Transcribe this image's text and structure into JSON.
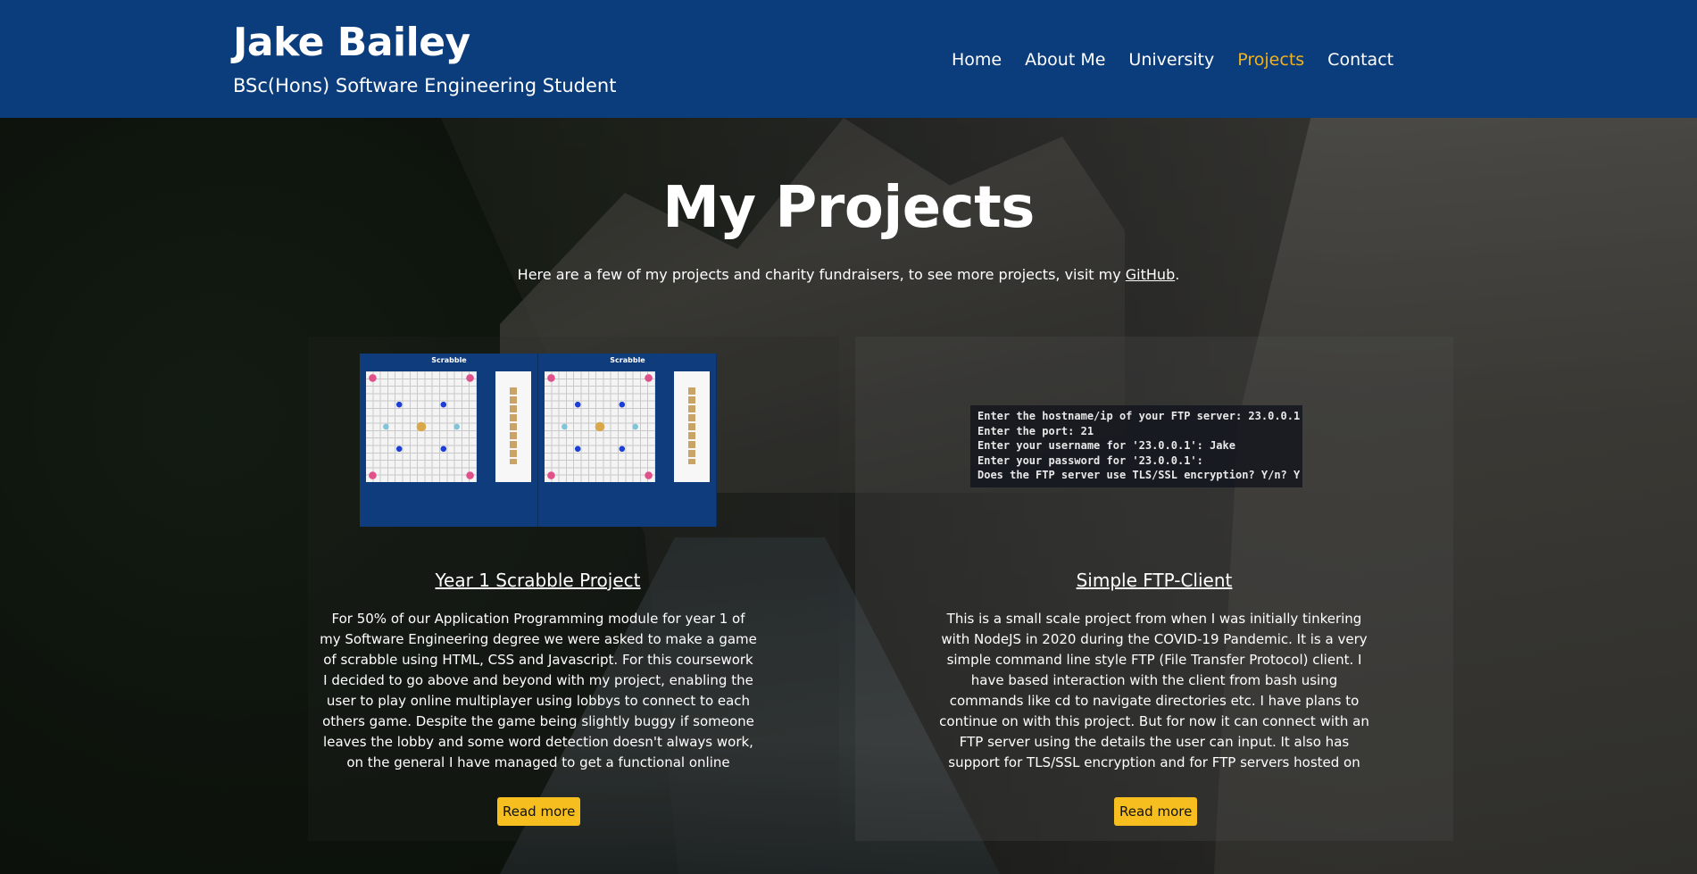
{
  "header": {
    "title": "Jake Bailey",
    "subtitle": "BSc(Hons) Software Engineering Student",
    "nav": [
      {
        "label": "Home",
        "active": false
      },
      {
        "label": "About Me",
        "active": false
      },
      {
        "label": "University",
        "active": false
      },
      {
        "label": "Projects",
        "active": true
      },
      {
        "label": "Contact",
        "active": false
      }
    ],
    "background_color": "#0b3c7c",
    "active_color": "#f2b21a"
  },
  "main": {
    "title": "My Projects",
    "intro_text": "Here are a few of my projects and charity fundraisers, to see more projects, visit my ",
    "intro_link": "GitHub",
    "intro_end": ".",
    "projects": [
      {
        "thumbnail_label_1": "Scrabble",
        "thumbnail_label_2": "Scrabble",
        "title": "Year 1 Scrabble Project",
        "body": "For 50% of our Application Programming module for year 1 of my Software Engineering degree we were asked to make a game of scrabble using HTML, CSS and Javascript. For this coursework I decided to go above and beyond with my project, enabling the user to play online multiplayer using lobbys to connect to each others game. Despite the game being slightly buggy if someone leaves the lobby and some word detection doesn't always work, on the general I have managed to get a functional online multiplayer",
        "button": "Read more"
      },
      {
        "terminal_lines": [
          "Enter the hostname/ip of your FTP server: 23.0.0.1",
          "Enter the port: 21",
          "Enter your username for '23.0.0.1': Jake",
          "Enter your password for '23.0.0.1':",
          "Does the FTP server use TLS/SSL encryption? Y/n? Y"
        ],
        "title": "Simple FTP-Client",
        "body": "This is a small scale project from when I was initially tinkering with NodeJS in 2020 during the COVID-19 Pandemic. It is a very simple command line style FTP (File Transfer Protocol) client. I have based interaction with the client from bash using commands like cd to navigate directories etc. I have plans to continue on with this project. But for now it can connect with an FTP server using the details the user can input. It also has support for TLS/SSL encryption and for FTP servers hosted on different ports. It can also currently",
        "button": "Read more"
      }
    ],
    "button_color": "#f6bf1f"
  }
}
